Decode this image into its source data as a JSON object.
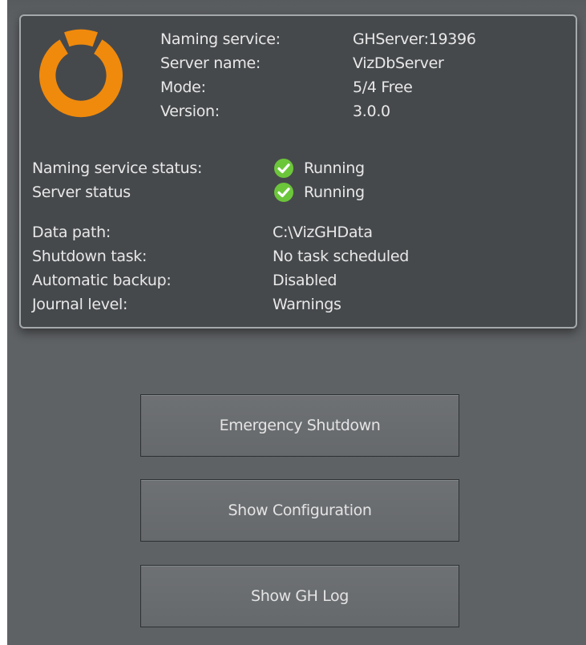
{
  "info": {
    "naming_service_label": "Naming service:",
    "naming_service_value": "GHServer:19396",
    "server_name_label": "Server name:",
    "server_name_value": "VizDbServer",
    "mode_label": "Mode:",
    "mode_value": "5/4 Free",
    "version_label": "Version:",
    "version_value": "3.0.0"
  },
  "status": {
    "naming_service_status_label": "Naming service status:",
    "naming_service_status_value": "Running",
    "server_status_label": "Server status",
    "server_status_value": "Running",
    "running_color": "#6cc63a"
  },
  "details": {
    "data_path_label": "Data path:",
    "data_path_value": "C:\\VizGHData",
    "shutdown_task_label": "Shutdown task:",
    "shutdown_task_value": "No task scheduled",
    "automatic_backup_label": "Automatic backup:",
    "automatic_backup_value": "Disabled",
    "journal_level_label": "Journal level:",
    "journal_level_value": "Warnings"
  },
  "buttons": {
    "emergency_shutdown": "Emergency Shutdown",
    "show_configuration": "Show Configuration",
    "show_gh_log": "Show GH Log"
  },
  "colors": {
    "brand_orange": "#f08a0c",
    "panel_bg": "#46494c",
    "app_bg": "#5f6265"
  }
}
